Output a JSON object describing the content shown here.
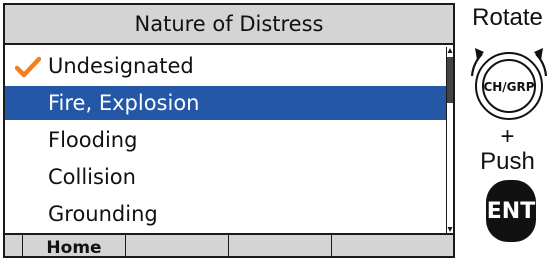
{
  "screen": {
    "title": "Nature of Distress",
    "items": [
      {
        "label": "Undesignated",
        "checked": true,
        "selected": false
      },
      {
        "label": "Fire, Explosion",
        "checked": false,
        "selected": true
      },
      {
        "label": "Flooding",
        "checked": false,
        "selected": false
      },
      {
        "label": "Collision",
        "checked": false,
        "selected": false
      },
      {
        "label": "Grounding",
        "checked": false,
        "selected": false
      }
    ],
    "softkeys": [
      "",
      "Home",
      "",
      "",
      ""
    ]
  },
  "controls": {
    "rotate_label": "Rotate",
    "knob_label": "CH/GRP",
    "plus_label": "+",
    "push_label": "Push",
    "ent_label": "ENT"
  },
  "colors": {
    "selection": "#2457a6",
    "check": "#f07f1e",
    "title_bar": "#d4d4d4"
  }
}
